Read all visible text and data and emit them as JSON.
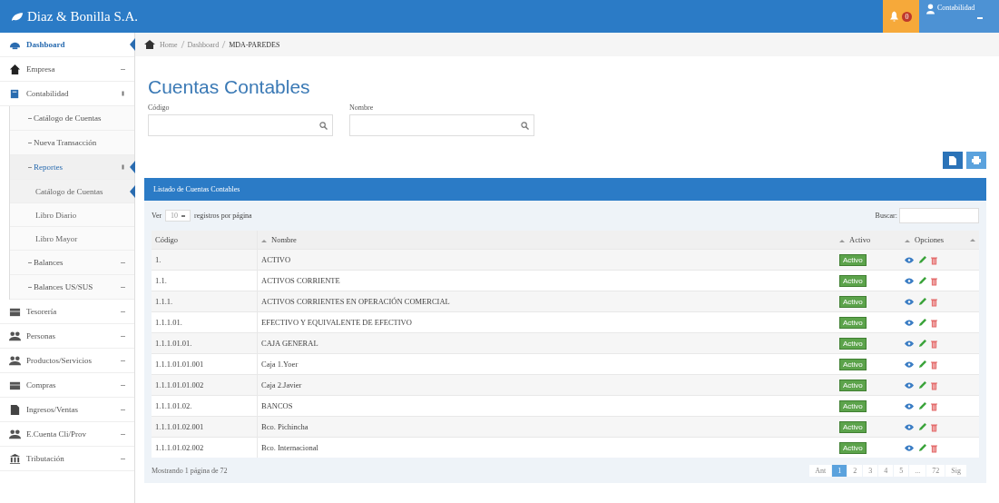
{
  "header": {
    "brand": "Diaz & Bonilla S.A.",
    "notifications": "0",
    "user": "Contabilidad"
  },
  "sidebar": {
    "items": [
      {
        "label": "Dashboard",
        "selected": true
      },
      {
        "label": "Empresa",
        "selected": false,
        "expanded": false
      },
      {
        "label": "Contabilidad",
        "selected": false,
        "expanded": true,
        "children": [
          {
            "label": "Catálogo de Cuentas",
            "selected": false
          },
          {
            "label": "Nueva Transacción",
            "selected": false
          },
          {
            "label": "Reportes",
            "selected": true,
            "expanded": true,
            "children": [
              {
                "label": "Catálogo de Cuentas",
                "selected": true
              },
              {
                "label": "Libro Diario",
                "selected": false
              },
              {
                "label": "Libro Mayor",
                "selected": false
              }
            ]
          },
          {
            "label": "Balances",
            "selected": false,
            "expanded": false
          },
          {
            "label": "Balances US/SUS",
            "selected": false,
            "expanded": false
          }
        ]
      },
      {
        "label": "Tesorería",
        "selected": false,
        "expanded": false
      },
      {
        "label": "Personas",
        "selected": false,
        "expanded": false
      },
      {
        "label": "Productos/Servicios",
        "selected": false,
        "expanded": false
      },
      {
        "label": "Compras",
        "selected": false,
        "expanded": false
      },
      {
        "label": "Ingresos/Ventas",
        "selected": false,
        "expanded": false
      },
      {
        "label": "E.Cuenta Cli/Prov",
        "selected": false,
        "expanded": false
      },
      {
        "label": "Tributación",
        "selected": false,
        "expanded": false
      }
    ]
  },
  "breadcrumb": [
    "Home",
    "Dashboard",
    "MDA-PAREDES"
  ],
  "page_title": "Cuentas Contables",
  "filters": [
    {
      "label": "Código"
    },
    {
      "label": "Nombre"
    }
  ],
  "panel": {
    "title": "Listado de Cuentas Contables",
    "length": {
      "prefix": "Ver",
      "value": "10",
      "suffix": "registros por página"
    },
    "search_label": "Buscar:",
    "columns": [
      "Código",
      "Nombre",
      "Activo",
      "Opciones"
    ],
    "rows": [
      {
        "code": "1.",
        "name": "ACTIVO",
        "status": "Activo"
      },
      {
        "code": "1.1.",
        "name": "ACTIVOS CORRIENTE",
        "status": "Activo"
      },
      {
        "code": "1.1.1.",
        "name": "ACTIVOS CORRIENTES EN OPERACIÓN COMERCIAL",
        "status": "Activo"
      },
      {
        "code": "1.1.1.01.",
        "name": "EFECTIVO Y EQUIVALENTE DE EFECTIVO",
        "status": "Activo"
      },
      {
        "code": "1.1.1.01.01.",
        "name": "CAJA GENERAL",
        "status": "Activo"
      },
      {
        "code": "1.1.1.01.01.001",
        "name": "Caja 1.Yoer",
        "status": "Activo"
      },
      {
        "code": "1.1.1.01.01.002",
        "name": "Caja 2.Javier",
        "status": "Activo"
      },
      {
        "code": "1.1.1.01.02.",
        "name": "BANCOS",
        "status": "Activo"
      },
      {
        "code": "1.1.1.01.02.001",
        "name": "Bco. Pichincha",
        "status": "Activo"
      },
      {
        "code": "1.1.1.01.02.002",
        "name": "Bco. Internacional",
        "status": "Activo"
      }
    ],
    "info": "Mostrando 1 página de 72",
    "pages": [
      {
        "label": "Ant",
        "selected": false
      },
      {
        "label": "1",
        "selected": true
      },
      {
        "label": "2",
        "selected": false
      },
      {
        "label": "3",
        "selected": false
      },
      {
        "label": "4",
        "selected": false
      },
      {
        "label": "5",
        "selected": false
      },
      {
        "label": "...",
        "selected": false
      },
      {
        "label": "72",
        "selected": false
      },
      {
        "label": "Sig",
        "selected": false
      }
    ]
  }
}
